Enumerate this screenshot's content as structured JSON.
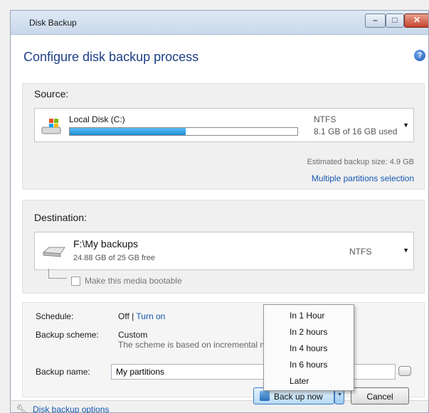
{
  "window": {
    "title": "Disk Backup"
  },
  "header": {
    "title": "Configure disk backup process"
  },
  "source": {
    "label": "Source:",
    "drive_name": "Local Disk (C:)",
    "file_system": "NTFS",
    "used_text": "8.1 GB of 16 GB used",
    "usage_fraction": 0.51,
    "estimated": "Estimated backup size: 4.9 GB",
    "multi_link": "Multiple partitions selection"
  },
  "destination": {
    "label": "Destination:",
    "path": "F:\\My backups",
    "free_text": "24.88 GB of 25 GB free",
    "file_system": "NTFS",
    "bootable_label": "Make this media bootable"
  },
  "schedule": {
    "label": "Schedule:",
    "value": "Off",
    "separator": "|",
    "turn_on": "Turn on"
  },
  "scheme": {
    "label": "Backup scheme:",
    "value": "Custom",
    "note": "The scheme is based on incremental m"
  },
  "backup_name": {
    "label": "Backup name:",
    "value": "My partitions"
  },
  "footer": {
    "options_link": "Disk backup options",
    "backup_button": "Back up now",
    "cancel_button": "Cancel"
  },
  "menu": {
    "items": [
      "In 1 Hour",
      "In 2 hours",
      "In 4 hours",
      "In 6 hours",
      "Later"
    ]
  },
  "colors": {
    "link": "#1558b0",
    "title": "#1e3f85",
    "usage_bar": "#1b8fd6"
  }
}
